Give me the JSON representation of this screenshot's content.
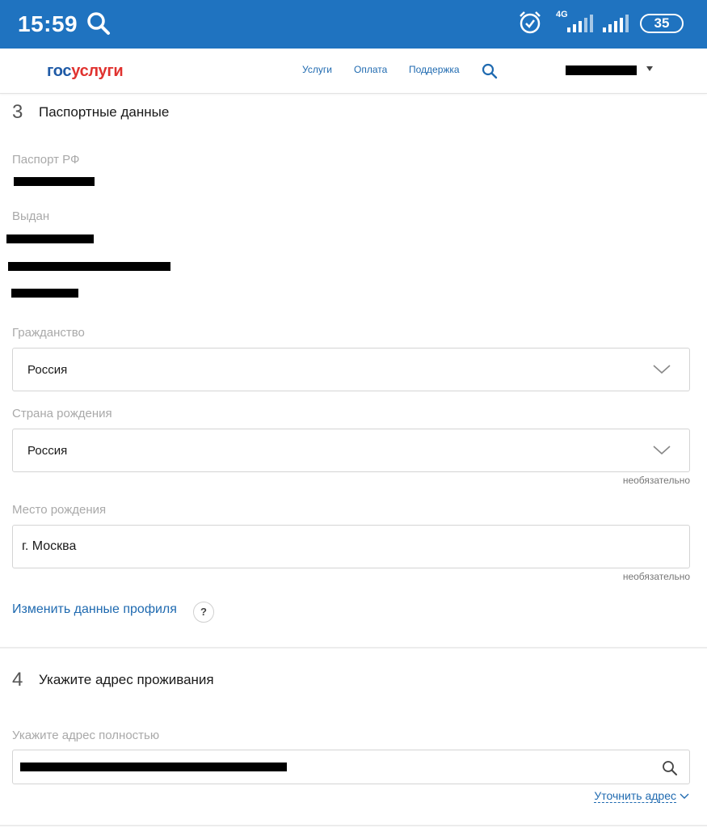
{
  "status_bar": {
    "time": "15:59",
    "network": "4G",
    "battery": "35",
    "background_color": "#1f73c0",
    "icons": [
      "search-icon",
      "alarm-icon",
      "signal-icon",
      "signal-icon",
      "battery-icon"
    ]
  },
  "header": {
    "logo_part1": "гос",
    "logo_part2": "услуги",
    "nav": [
      "Услуги",
      "Оплата",
      "Поддержка"
    ],
    "brand_blue": "#1f5aa6",
    "brand_red": "#e0322f",
    "link_color": "#1f6ab0"
  },
  "section3": {
    "number": "3",
    "title": "Паспортные данные",
    "passport_label": "Паспорт РФ",
    "issued_label": "Выдан",
    "citizenship_label": "Гражданство",
    "citizenship_value": "Россия",
    "birth_country_label": "Страна рождения",
    "birth_country_value": "Россия",
    "optional_1": "необязательно",
    "birthplace_label": "Место рождения",
    "birthplace_value": "г. Москва",
    "optional_2": "необязательно",
    "edit_profile_link": "Изменить данные профиля",
    "help_glyph": "?"
  },
  "section4": {
    "number": "4",
    "title": "Укажите адрес проживания",
    "address_label": "Укажите адрес полностью",
    "refine_link": "Уточнить адрес"
  }
}
